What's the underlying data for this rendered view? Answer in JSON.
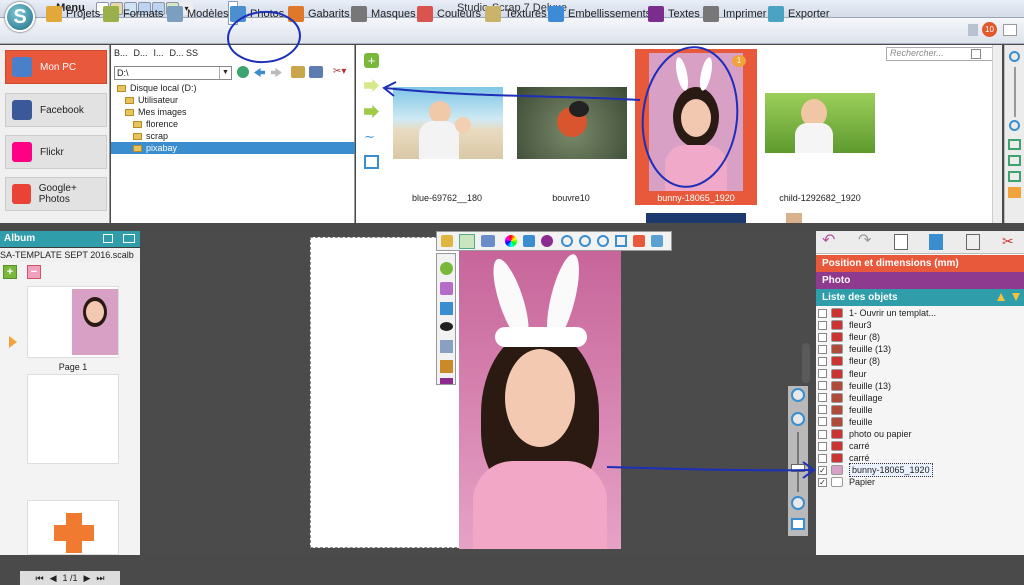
{
  "window": {
    "title": "Studio-Scrap 7 Deluxe",
    "menu_label": "Menu"
  },
  "toolbar": {
    "items": [
      {
        "label": "Projets",
        "icon": "folder-icon",
        "color": "#e3a83a"
      },
      {
        "label": "Formats",
        "icon": "formats-icon",
        "color": "#9ab04a"
      },
      {
        "label": "Modèles",
        "icon": "templates-icon",
        "color": "#7d9fbf"
      },
      {
        "label": "Photos",
        "icon": "photos-icon",
        "color": "#4b8fd1"
      },
      {
        "label": "Gabarits",
        "icon": "puzzle-icon",
        "color": "#e0782c"
      },
      {
        "label": "Masques",
        "icon": "mask-icon",
        "color": "#777777"
      },
      {
        "label": "Couleurs",
        "icon": "color-wheel-icon",
        "color": "#d9534f"
      },
      {
        "label": "Textures",
        "icon": "textures-icon",
        "color": "#c9b46a"
      },
      {
        "label": "Embellissements",
        "icon": "embellish-icon",
        "color": "#3d8bd6"
      },
      {
        "label": "Textes",
        "icon": "text-icon",
        "color": "#7b2c8f"
      },
      {
        "label": "Imprimer",
        "icon": "printer-icon",
        "color": "#777777"
      },
      {
        "label": "Exporter",
        "icon": "export-icon",
        "color": "#4aa3c3"
      }
    ],
    "notification_count": "10"
  },
  "sources": [
    {
      "label": "Mon PC",
      "icon": "monitor-icon",
      "active": true
    },
    {
      "label": "Facebook",
      "icon": "facebook-icon",
      "active": false
    },
    {
      "label": "Flickr",
      "icon": "flickr-icon",
      "active": false
    },
    {
      "label": "Google+ Photos",
      "icon": "google-photos-icon",
      "active": false
    }
  ],
  "tree": {
    "tabs": [
      "B...",
      "D...",
      "I...",
      "D... SS"
    ],
    "path": "D:\\",
    "nodes": [
      {
        "label": "Disque local (D:)",
        "depth": 0
      },
      {
        "label": "Utilisateur",
        "depth": 1
      },
      {
        "label": "Mes images",
        "depth": 1
      },
      {
        "label": "florence",
        "depth": 2
      },
      {
        "label": "scrap",
        "depth": 2
      },
      {
        "label": "pixabay",
        "depth": 2,
        "selected": true
      }
    ]
  },
  "browser": {
    "search_placeholder": "Rechercher...",
    "photos": [
      {
        "name": "blue-69762__180"
      },
      {
        "name": "bouvre10"
      },
      {
        "name": "bunny-18065_1920",
        "selected": true,
        "badge": "1"
      },
      {
        "name": "child-1292682_1920"
      }
    ]
  },
  "album": {
    "title": "Album",
    "file": "SA-TEMPLATE SEPT 2016.scalb",
    "pages": [
      {
        "label": "Page 1"
      }
    ],
    "pager": "1 /1"
  },
  "props": {
    "sections": [
      {
        "label": "Position et dimensions (mm)",
        "color": "#e8583a"
      },
      {
        "label": "Photo",
        "color": "#8e3a8f"
      },
      {
        "label": "Liste des objets",
        "color": "#2f9eaa"
      }
    ],
    "objects": [
      {
        "name": "1- Ouvrir un templat...",
        "checked": false
      },
      {
        "name": "fleur3",
        "checked": false
      },
      {
        "name": "fleur (8)",
        "checked": false
      },
      {
        "name": "feuille (13)",
        "checked": false
      },
      {
        "name": "fleur (8)",
        "checked": false
      },
      {
        "name": "fleur",
        "checked": false
      },
      {
        "name": "feuille (13)",
        "checked": false
      },
      {
        "name": "feuillage",
        "checked": false
      },
      {
        "name": "feuille",
        "checked": false
      },
      {
        "name": "feuille",
        "checked": false
      },
      {
        "name": "photo ou papier",
        "checked": false
      },
      {
        "name": "carré",
        "checked": false
      },
      {
        "name": "carré",
        "checked": false
      },
      {
        "name": "bunny-18065_1920",
        "checked": true,
        "selected": true
      },
      {
        "name": "Papier",
        "checked": true
      }
    ]
  }
}
